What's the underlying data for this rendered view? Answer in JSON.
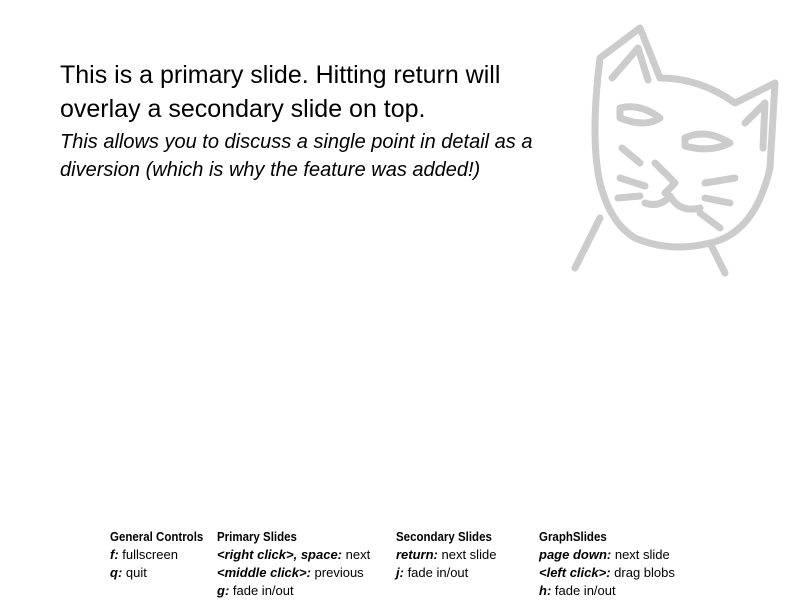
{
  "slide": {
    "primary_text": "This is a primary slide. Hitting return will overlay a secondary slide on top.",
    "secondary_text": "This allows you to discuss a single point in detail as a diversion (which is why the feature was added!)"
  },
  "logo": {
    "icon": "cat-face-icon",
    "stroke_color": "#cccccc"
  },
  "controls": {
    "general": {
      "title": "General Controls",
      "items": [
        {
          "key": "f:",
          "action": "fullscreen"
        },
        {
          "key": "q:",
          "action": "quit"
        }
      ]
    },
    "primary": {
      "title": "Primary Slides",
      "items": [
        {
          "key": "<right click>, space:",
          "action": "next"
        },
        {
          "key": "<middle click>:",
          "action": "previous"
        },
        {
          "key": "g:",
          "action": "fade in/out"
        }
      ]
    },
    "secondary": {
      "title": "Secondary Slides",
      "items": [
        {
          "key": "return:",
          "action": "next slide"
        },
        {
          "key": "j:",
          "action": "fade in/out"
        }
      ]
    },
    "graph": {
      "title": "GraphSlides",
      "items": [
        {
          "key": "page down:",
          "action": "next slide"
        },
        {
          "key": "<left click>:",
          "action": "drag blobs"
        },
        {
          "key": "h:",
          "action": "fade in/out"
        }
      ]
    }
  }
}
